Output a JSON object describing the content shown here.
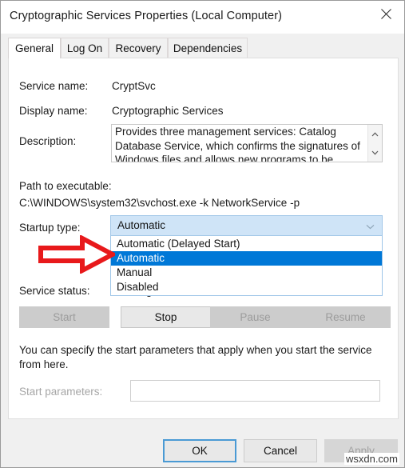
{
  "window": {
    "title": "Cryptographic Services Properties (Local Computer)",
    "close_icon": "close-icon"
  },
  "tabs": [
    {
      "label": "General",
      "active": true
    },
    {
      "label": "Log On",
      "active": false
    },
    {
      "label": "Recovery",
      "active": false
    },
    {
      "label": "Dependencies",
      "active": false
    }
  ],
  "general": {
    "service_name_label": "Service name:",
    "service_name_value": "CryptSvc",
    "display_name_label": "Display name:",
    "display_name_value": "Cryptographic Services",
    "description_label": "Description:",
    "description_text": "Provides three management services: Catalog Database Service, which confirms the signatures of Windows files and allows new programs to be",
    "path_label": "Path to executable:",
    "path_value": "C:\\WINDOWS\\system32\\svchost.exe -k NetworkService -p",
    "startup_type_label": "Startup type:",
    "startup_type_value": "Automatic",
    "startup_options": [
      {
        "label": "Automatic (Delayed Start)",
        "selected": false
      },
      {
        "label": "Automatic",
        "selected": true
      },
      {
        "label": "Manual",
        "selected": false
      },
      {
        "label": "Disabled",
        "selected": false
      }
    ],
    "service_status_label": "Service status:",
    "service_status_value": "Running",
    "control_buttons": [
      {
        "label": "Start",
        "enabled": false
      },
      {
        "label": "Stop",
        "enabled": true
      },
      {
        "label": "Pause",
        "enabled": false
      },
      {
        "label": "Resume",
        "enabled": false
      }
    ],
    "start_params_hint": "You can specify the start parameters that apply when you start the service from here.",
    "start_params_label": "Start parameters:",
    "start_params_value": ""
  },
  "footer": {
    "ok_label": "OK",
    "cancel_label": "Cancel",
    "apply_label": "Apply"
  },
  "watermark": "wsxdn.com",
  "colors": {
    "highlight": "#0078d7",
    "combo_bg": "#cfe4f7",
    "annotation_arrow": "#e8191b",
    "focus_border": "#4a9ad4"
  }
}
